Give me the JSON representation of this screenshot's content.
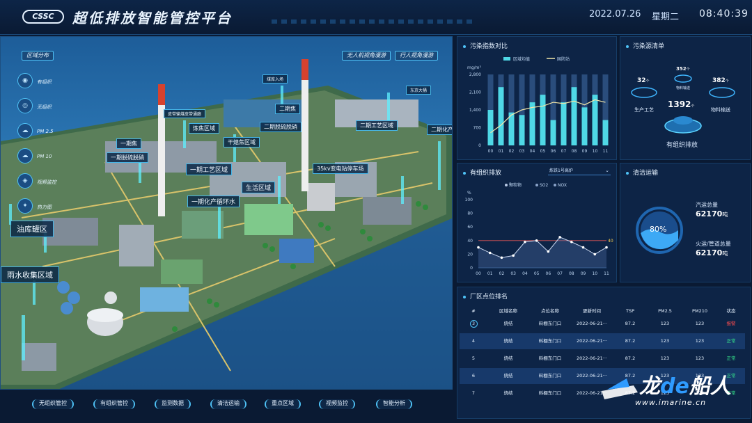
{
  "header": {
    "logo": "CSSC",
    "title": "超低排放智能管控平台",
    "date": "2022.07.26",
    "weekday": "星期二",
    "time": "08:40:39"
  },
  "map": {
    "region_chip": "区域分布",
    "view_buttons": [
      "无人机视角漫游",
      "行人视角漫游"
    ],
    "side_buttons": [
      {
        "icon": "有组织-icon",
        "label": "有组织"
      },
      {
        "icon": "无组织-icon",
        "label": "无组织"
      },
      {
        "icon": "pm25-icon",
        "label": "PM 2.5"
      },
      {
        "icon": "pm10-icon",
        "label": "PM 10"
      },
      {
        "icon": "viewing-icon",
        "label": "视频监控"
      },
      {
        "icon": "heat-icon",
        "label": "热力图"
      }
    ],
    "labels": [
      "油库罐区",
      "雨水收集区域",
      "一期化产循环水",
      "生活区域",
      "一期工艺区域",
      "35kv变电站停车场",
      "一期焦",
      "一期脱硫脱硝",
      "炼焦区域",
      "二期脱硫脱硝",
      "干熄焦区域",
      "二期工艺区域",
      "二期化产",
      "二期焦",
      "皮带输煤皮带通廊",
      "煤库入场",
      "东京大桶"
    ]
  },
  "bottom_nav": [
    "无组织管控",
    "有组织管控",
    "监测数据",
    "清洁运输",
    "重点区域",
    "视频监控",
    "智能分析"
  ],
  "pollution_index": {
    "title": "污染指数对比",
    "legend": [
      "区域均值",
      "国防站"
    ],
    "unit": "mg/m³",
    "yticks": [
      "2,800",
      "2,100",
      "1,400",
      "700",
      "0"
    ],
    "xticks": [
      "00",
      "01",
      "02",
      "03",
      "04",
      "05",
      "06",
      "07",
      "08",
      "09",
      "10",
      "11"
    ],
    "colors": {
      "bar": "#4fd8e6",
      "bar_bg": "#2a4d7c",
      "line": "#f3e6a8"
    }
  },
  "pollution_sources": {
    "title": "污染源清单",
    "items": [
      {
        "value": "32",
        "unit": "个",
        "label": "生产工艺"
      },
      {
        "value": "352",
        "unit": "个",
        "label": "物料输送"
      },
      {
        "value": "382",
        "unit": "个",
        "label": "物料输送"
      },
      {
        "value": "1392",
        "unit": "个",
        "label": "有组织排放"
      }
    ]
  },
  "organized_emission": {
    "title": "有组织排放",
    "selected": "炼铁1号高炉",
    "legend": [
      "颗粒物",
      "SO2",
      "NOX"
    ],
    "unit": "%",
    "yticks": [
      "100",
      "80",
      "60",
      "40",
      "20",
      "0"
    ],
    "xticks": [
      "00",
      "01",
      "02",
      "03",
      "04",
      "05",
      "06",
      "07",
      "08",
      "09",
      "10",
      "11"
    ],
    "threshold_label": "40"
  },
  "clean_transport": {
    "title": "清洁运输",
    "percent": "80%",
    "truck_label": "汽运总量",
    "truck_value": "62170",
    "truck_unit": "吨",
    "rail_label": "火运/管道总量",
    "rail_value": "62170",
    "rail_unit": "吨"
  },
  "ranking": {
    "title": "厂区点位排名",
    "headers": [
      "#",
      "区域名称",
      "点位名称",
      "更新时间",
      "TSP",
      "PM2.5",
      "PM210",
      "状态"
    ],
    "rows": [
      {
        "rank": "3",
        "area": "烧结",
        "point": "料棚东门口",
        "time": "2022-06-21···",
        "tsp": "87.2",
        "pm25": "123",
        "pm210": "123",
        "status": "报警"
      },
      {
        "rank": "4",
        "area": "烧结",
        "point": "料棚东门口",
        "time": "2022-06-21···",
        "tsp": "87.2",
        "pm25": "123",
        "pm210": "123",
        "status": "正常"
      },
      {
        "rank": "5",
        "area": "烧结",
        "point": "料棚东门口",
        "time": "2022-06-21···",
        "tsp": "87.2",
        "pm25": "123",
        "pm210": "123",
        "status": "正常"
      },
      {
        "rank": "6",
        "area": "烧结",
        "point": "料棚东门口",
        "time": "2022-06-21···",
        "tsp": "87.2",
        "pm25": "123",
        "pm210": "123",
        "status": "正常"
      },
      {
        "rank": "7",
        "area": "烧结",
        "point": "料棚东门口",
        "time": "2022-06-21···",
        "tsp": "87.2",
        "pm25": "123",
        "pm210": "123",
        "status": "正常"
      }
    ]
  },
  "watermark": {
    "text_a": "龙",
    "text_b": "de",
    "text_c": "船人",
    "url": "www.imarine.cn"
  },
  "chart_data": [
    {
      "type": "bar",
      "title": "污染指数对比",
      "ylabel": "mg/m³",
      "ylim": [
        0,
        2800
      ],
      "categories": [
        "00",
        "01",
        "02",
        "03",
        "04",
        "05",
        "06",
        "07",
        "08",
        "09",
        "10",
        "11"
      ],
      "series": [
        {
          "name": "区域均值",
          "type": "bar",
          "values": [
            1400,
            2300,
            1300,
            1200,
            1700,
            2000,
            1000,
            1700,
            2300,
            1500,
            2000,
            1000
          ]
        },
        {
          "name": "国防站",
          "type": "line",
          "values": [
            500,
            800,
            1200,
            1400,
            1500,
            1550,
            1700,
            1650,
            1750,
            1600,
            1800,
            1700
          ]
        }
      ],
      "legend": "top"
    },
    {
      "type": "line",
      "title": "有组织排放",
      "ylabel": "%",
      "ylim": [
        0,
        100
      ],
      "categories": [
        "00",
        "01",
        "02",
        "03",
        "04",
        "05",
        "06",
        "07",
        "08",
        "09",
        "10",
        "11"
      ],
      "series": [
        {
          "name": "颗粒物",
          "values": [
            30,
            22,
            15,
            18,
            38,
            40,
            24,
            45,
            38,
            30,
            20,
            30
          ]
        },
        {
          "name": "SO2",
          "values": []
        },
        {
          "name": "NOX",
          "values": []
        }
      ],
      "threshold": 40,
      "legend": "top"
    }
  ]
}
